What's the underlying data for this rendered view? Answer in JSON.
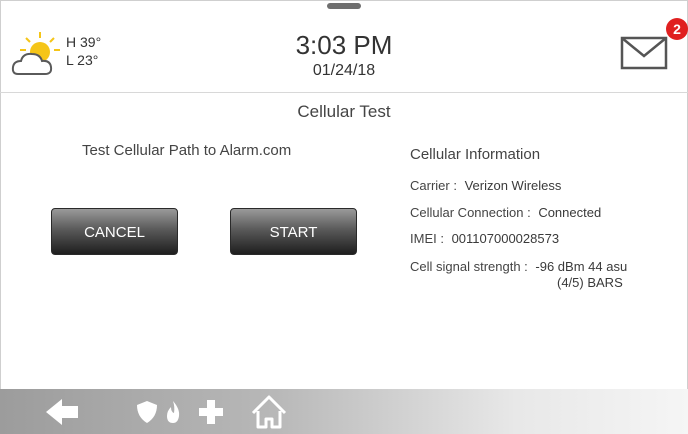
{
  "header": {
    "weather": {
      "high": "H 39°",
      "low": "L 23°",
      "icon": "partly-cloudy-icon"
    },
    "time": "3:03 PM",
    "date": "01/24/18",
    "messages": {
      "icon": "mail-icon",
      "badge_count": "2"
    }
  },
  "screen": {
    "title": "Cellular Test",
    "subtitle": "Test Cellular Path to Alarm.com"
  },
  "buttons": {
    "cancel_label": "CANCEL",
    "start_label": "START"
  },
  "cellular_info": {
    "heading": "Cellular Information",
    "carrier": {
      "label": "Carrier :",
      "value": "Verizon Wireless"
    },
    "connection": {
      "label": "Cellular Connection :",
      "value": "Connected"
    },
    "imei": {
      "label": "IMEI :",
      "value": "001107000028573"
    },
    "signal": {
      "label": "Cell signal strength :",
      "value": "-96 dBm 44 asu",
      "bars": "(4/5) BARS"
    }
  },
  "navbar": {
    "items": [
      "back-arrow-icon",
      "shield-icon",
      "fire-icon",
      "plus-icon",
      "home-icon"
    ]
  },
  "colors": {
    "badge": "#e02020",
    "sun": "#f5c518",
    "button_dark": "#1e1e1e"
  }
}
